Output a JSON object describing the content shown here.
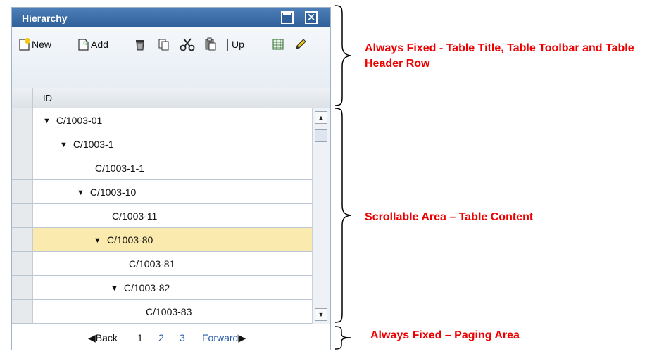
{
  "window": {
    "title": "Hierarchy"
  },
  "toolbar": {
    "new_label": "New",
    "add_label": "Add",
    "up_label": "Up",
    "icons": [
      "new-icon",
      "add-icon",
      "delete-icon",
      "copy-icon",
      "cut-icon",
      "paste-icon",
      "excel-export-icon",
      "edit-icon"
    ]
  },
  "table": {
    "column_header": "ID",
    "rows": [
      {
        "id": "C/1003-01",
        "expanded": true
      },
      {
        "id": "C/1003-1",
        "expanded": true
      },
      {
        "id": "C/1003-1-1",
        "expanded": null
      },
      {
        "id": "C/1003-10",
        "expanded": true
      },
      {
        "id": "C/1003-11",
        "expanded": null
      },
      {
        "id": "C/1003-80",
        "expanded": true,
        "selected": true
      },
      {
        "id": "C/1003-81",
        "expanded": null
      },
      {
        "id": "C/1003-82",
        "expanded": true
      },
      {
        "id": "C/1003-83",
        "expanded": null
      }
    ]
  },
  "paging": {
    "back_label": "Back",
    "pages": [
      "1",
      "2",
      "3"
    ],
    "current_page": "1",
    "forward_label": "Forward"
  },
  "annotations": {
    "fixed_top": "Always Fixed - Table Title, Table Toolbar and Table Header Row",
    "scrollable": "Scrollable Area – Table Content",
    "fixed_paging": "Always Fixed – Paging Area"
  },
  "colors": {
    "title_bar": "#3a6da8",
    "selected_row": "#fbeaad",
    "annotation": "#ee0000",
    "link": "#2a5ca8"
  }
}
